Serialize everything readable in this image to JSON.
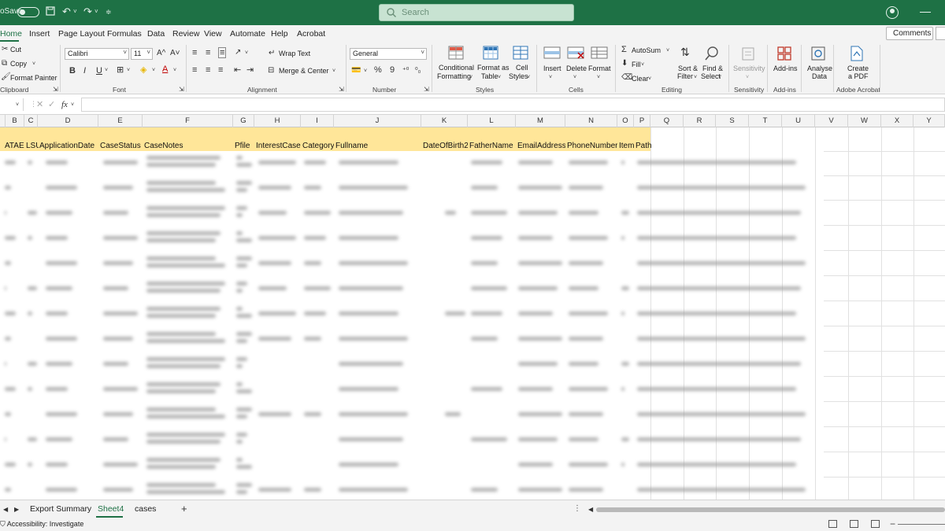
{
  "titlebar": {
    "autosave_label": "oSave",
    "search_placeholder": "Search"
  },
  "menu": {
    "tabs": [
      "Home",
      "Insert",
      "Page Layout",
      "Formulas",
      "Data",
      "Review",
      "View",
      "Automate",
      "Help",
      "Acrobat"
    ],
    "active_tab": "Home",
    "comments_label": "Comments"
  },
  "ribbon": {
    "clipboard": {
      "cut": "Cut",
      "copy": "Copy",
      "format_painter": "Format Painter",
      "group": "Clipboard"
    },
    "font": {
      "name": "Calibri",
      "size": "11",
      "grow": "A^",
      "shrink": "A˅",
      "bold": "B",
      "italic": "I",
      "underline": "U",
      "group": "Font"
    },
    "alignment": {
      "wrap_text": "Wrap Text",
      "merge_center": "Merge & Center",
      "group": "Alignment"
    },
    "number": {
      "format": "General",
      "percent": "%",
      "comma": "9",
      "group": "Number"
    },
    "styles": {
      "conditional_1": "Conditional",
      "conditional_2": "Formatting",
      "format_table_1": "Format as",
      "format_table_2": "Table",
      "cell_styles_1": "Cell",
      "cell_styles_2": "Styles",
      "group": "Styles"
    },
    "cells": {
      "insert": "Insert",
      "delete": "Delete",
      "format": "Format",
      "group": "Cells"
    },
    "editing": {
      "autosum": "AutoSum",
      "fill": "Fill",
      "clear": "Clear",
      "sort_1": "Sort &",
      "sort_2": "Filter",
      "find_1": "Find &",
      "find_2": "Select",
      "group": "Editing"
    },
    "sensitivity": {
      "label": "Sensitivity",
      "group": "Sensitivity"
    },
    "addins": {
      "label": "Add-ins",
      "group": "Add-ins"
    },
    "analyse": {
      "label_1": "Analyse",
      "label_2": "Data"
    },
    "acrobat": {
      "label_1": "Create",
      "label_2": "a PDF",
      "group": "Adobe Acrobat"
    }
  },
  "formula_bar": {
    "fx": "fx"
  },
  "columns": [
    "B",
    "C",
    "D",
    "E",
    "F",
    "G",
    "H",
    "I",
    "J",
    "K",
    "L",
    "M",
    "N",
    "O",
    "P",
    "Q",
    "R",
    "S",
    "T",
    "U",
    "V",
    "W",
    "X",
    "Y"
  ],
  "headers": [
    "ATAE",
    "LSU",
    "ApplicationDate",
    "CaseStatus",
    "CaseNotes",
    "Pfile",
    "InterestCase",
    "Category",
    "Fullname",
    "DateOfBirth2",
    "FatherName",
    "EmailAddress",
    "PhoneNumber",
    "Item",
    "Path"
  ],
  "sheets": {
    "tabs": [
      "Export Summary",
      "Sheet4",
      "cases"
    ],
    "active": "Sheet4"
  },
  "status": {
    "accessibility": "Accessibility: Investigate"
  },
  "colors": {
    "brand_green": "#1e7145",
    "header_fill": "#ffe699"
  }
}
